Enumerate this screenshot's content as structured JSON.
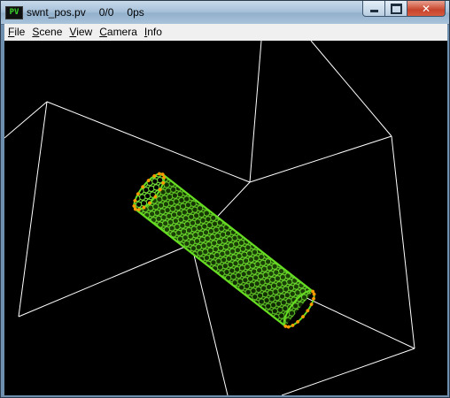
{
  "window": {
    "app_icon_text": "PV",
    "title_filename": "swnt_pos.pv",
    "title_frame": "0/0",
    "title_time": "0ps",
    "icons": {
      "minimize": "minimize-icon",
      "maximize": "maximize-icon",
      "close": "close-icon"
    }
  },
  "menu": {
    "items": [
      {
        "label": "File"
      },
      {
        "label": "Scene"
      },
      {
        "label": "View"
      },
      {
        "label": "Camera"
      },
      {
        "label": "Info"
      }
    ]
  },
  "scene": {
    "background_color": "#000000",
    "box_color": "#ffffff",
    "tube_color": "#66dd22",
    "tube_dark_color": "#1e5c00",
    "cap_atom_color": "#ff9900"
  }
}
